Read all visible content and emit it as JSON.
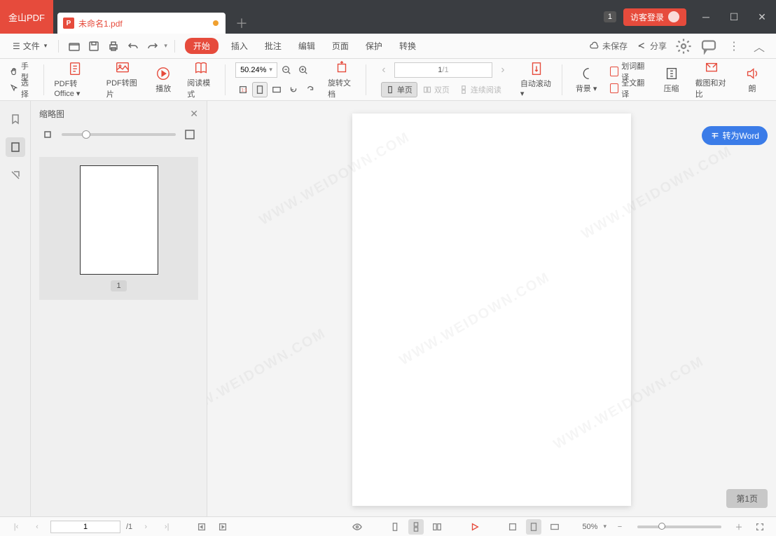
{
  "app": {
    "name": "金山PDF"
  },
  "tab": {
    "title": "未命名1.pdf",
    "modified": true
  },
  "titlebar": {
    "badge": "1",
    "login": "访客登录"
  },
  "menubar": {
    "file": "文件",
    "start": "开始",
    "items": [
      "插入",
      "批注",
      "编辑",
      "页面",
      "保护",
      "转换"
    ],
    "save_status": "未保存",
    "share": "分享"
  },
  "ribbon": {
    "hand": "手型",
    "select": "选择",
    "pdf_to_office": "PDF转Office",
    "pdf_to_image": "PDF转图片",
    "play": "播放",
    "read_mode": "阅读模式",
    "zoom_value": "50.24%",
    "rotate": "旋转文档",
    "page_current": "1",
    "page_total": "/1",
    "single_page": "单页",
    "double_page": "双页",
    "continuous": "连续阅读",
    "auto_scroll": "自动滚动",
    "background": "背景",
    "word_trans": "划词翻译",
    "full_trans": "全文翻译",
    "compress": "压缩",
    "screenshot_compare": "截图和对比",
    "read_aloud": "朗"
  },
  "sidepanel": {
    "title": "缩略图",
    "thumb_label": "1"
  },
  "canvas": {
    "convert_word": "转为Word",
    "page_indicator": "第1页"
  },
  "statusbar": {
    "page_current": "1",
    "page_total": "/1",
    "zoom": "50%"
  },
  "watermark": "WWW.WEIDOWN.COM"
}
